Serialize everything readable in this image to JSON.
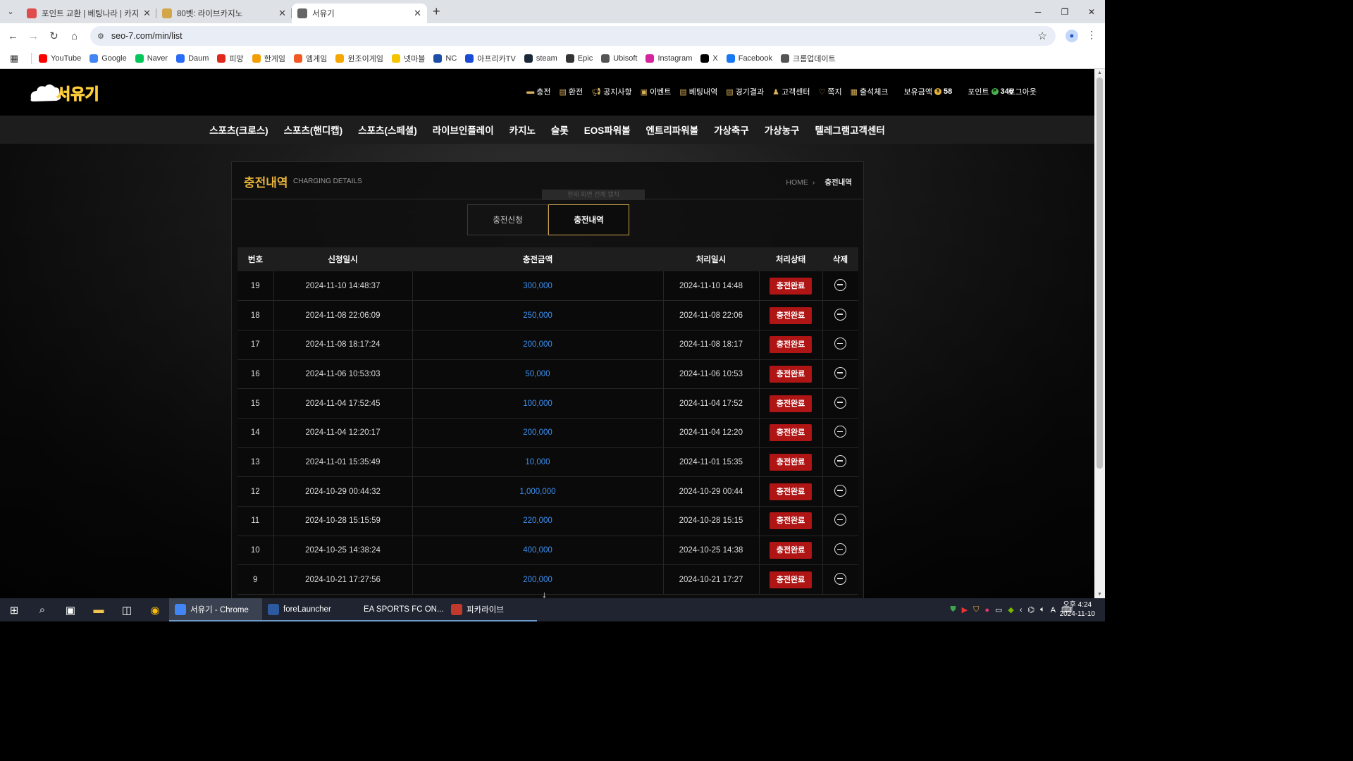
{
  "browser": {
    "tabs": [
      {
        "title": "포인트 교환 | 베팅나라 | 카지노",
        "active": false,
        "fav_color": "#e04b4b"
      },
      {
        "title": "80벳: 라이브카지노",
        "active": false,
        "fav_color": "#d3a64a"
      },
      {
        "title": "서유기",
        "active": true,
        "fav_color": "#666666"
      }
    ],
    "url": "seo-7.com/min/list",
    "bookmarks": [
      {
        "label": "YouTube",
        "color": "#ff0000"
      },
      {
        "label": "Google",
        "color": "#4285f4"
      },
      {
        "label": "Naver",
        "color": "#03c75a"
      },
      {
        "label": "Daum",
        "color": "#2a6df4"
      },
      {
        "label": "피망",
        "color": "#e0281c"
      },
      {
        "label": "한게임",
        "color": "#f29f05"
      },
      {
        "label": "엠게임",
        "color": "#f05a22"
      },
      {
        "label": "윈조이게임",
        "color": "#f5a700"
      },
      {
        "label": "넷마블",
        "color": "#f5c400"
      },
      {
        "label": "NC",
        "color": "#1b4fa8"
      },
      {
        "label": "아프리카TV",
        "color": "#1a4bd6"
      },
      {
        "label": "steam",
        "color": "#1b2838"
      },
      {
        "label": "Epic",
        "color": "#333333"
      },
      {
        "label": "Ubisoft",
        "color": "#555555"
      },
      {
        "label": "Instagram",
        "color": "#d6249f"
      },
      {
        "label": "X",
        "color": "#000000"
      },
      {
        "label": "Facebook",
        "color": "#1877f2"
      },
      {
        "label": "크롬업데이트",
        "color": "#555555"
      }
    ]
  },
  "site": {
    "logo_text": "서유기",
    "top_links": [
      "충전",
      "환전",
      "공지사항",
      "이벤트",
      "베팅내역",
      "경기결과",
      "고객센터",
      "쪽지",
      "출석체크"
    ],
    "balance_label": "보유금액",
    "balance_value": "58",
    "point_label": "포인트",
    "point_value": "346",
    "logout": "로그아웃",
    "main_nav": [
      "스포츠(크로스)",
      "스포츠(핸디캡)",
      "스포츠(스페셜)",
      "라이브인플레이",
      "카지노",
      "슬롯",
      "EOS파워볼",
      "엔트리파워볼",
      "가상축구",
      "가상농구",
      "텔레그램고객센터"
    ],
    "accent_color": "#e7b23a"
  },
  "panel": {
    "title": "충전내역",
    "subtitle": "CHARGING DETAILS",
    "breadcrumb_home": "HOME",
    "breadcrumb_current": "충전내역",
    "ghost_text": "현재 화면 전체 캡처",
    "tabs": [
      "충전신청",
      "충전내역"
    ],
    "columns": [
      "번호",
      "신청일시",
      "충전금액",
      "처리일시",
      "처리상태",
      "삭제"
    ],
    "rows": [
      {
        "no": "19",
        "req": "2024-11-10 14:48:37",
        "amount": "300,000",
        "done": "2024-11-10 14:48",
        "status": "충전완료"
      },
      {
        "no": "18",
        "req": "2024-11-08 22:06:09",
        "amount": "250,000",
        "done": "2024-11-08 22:06",
        "status": "충전완료"
      },
      {
        "no": "17",
        "req": "2024-11-08 18:17:24",
        "amount": "200,000",
        "done": "2024-11-08 18:17",
        "status": "충전완료"
      },
      {
        "no": "16",
        "req": "2024-11-06 10:53:03",
        "amount": "50,000",
        "done": "2024-11-06 10:53",
        "status": "충전완료"
      },
      {
        "no": "15",
        "req": "2024-11-04 17:52:45",
        "amount": "100,000",
        "done": "2024-11-04 17:52",
        "status": "충전완료"
      },
      {
        "no": "14",
        "req": "2024-11-04 12:20:17",
        "amount": "200,000",
        "done": "2024-11-04 12:20",
        "status": "충전완료"
      },
      {
        "no": "13",
        "req": "2024-11-01 15:35:49",
        "amount": "10,000",
        "done": "2024-11-01 15:35",
        "status": "충전완료"
      },
      {
        "no": "12",
        "req": "2024-10-29 00:44:32",
        "amount": "1,000,000",
        "done": "2024-10-29 00:44",
        "status": "충전완료"
      },
      {
        "no": "11",
        "req": "2024-10-28 15:15:59",
        "amount": "220,000",
        "done": "2024-10-28 15:15",
        "status": "충전완료"
      },
      {
        "no": "10",
        "req": "2024-10-25 14:38:24",
        "amount": "400,000",
        "done": "2024-10-25 14:38",
        "status": "충전완료"
      },
      {
        "no": "9",
        "req": "2024-10-21 17:27:56",
        "amount": "200,000",
        "done": "2024-10-21 17:27",
        "status": "충전완료"
      }
    ]
  },
  "taskbar": {
    "apps": [
      {
        "label": "서유기 - Chrome",
        "color": "#4285f4",
        "active": true
      },
      {
        "label": "foreLauncher",
        "color": "#2c5aa0",
        "active": false
      },
      {
        "label": "EA SPORTS FC ON...",
        "color": "#1e88e5",
        "active": false
      },
      {
        "label": "피카라이브",
        "color": "#c0392b",
        "active": false
      }
    ],
    "time": "오후 4:24",
    "date": "2024-11-10",
    "ime": "A"
  }
}
